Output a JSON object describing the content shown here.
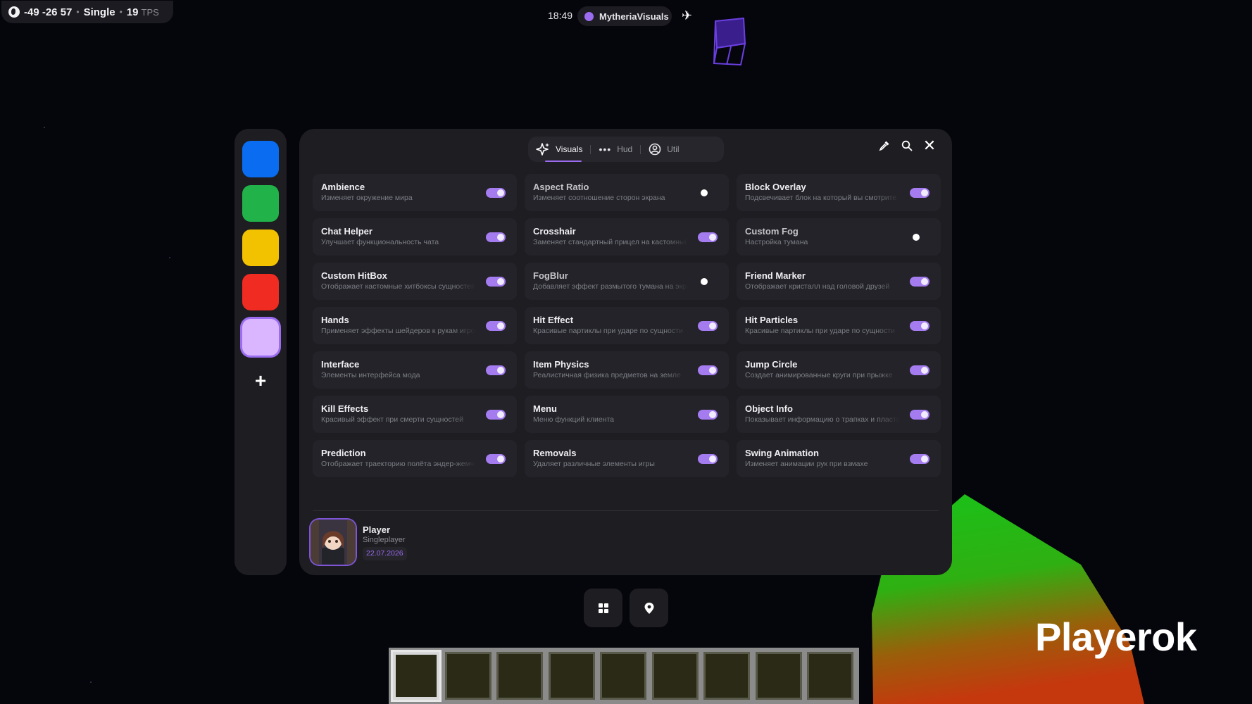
{
  "hud": {
    "coordinates": "-49 -26 57",
    "mode": "Single",
    "tps_value": "19",
    "tps_unit": "TPS",
    "time": "18:49",
    "client_name": "MytheriaVisuals"
  },
  "colors": {
    "accent": "#9b6bf0",
    "swatches": [
      "#0a6cf0",
      "#21b34a",
      "#f2c200",
      "#ef2b22",
      "#d9b6ff"
    ]
  },
  "color_panel": {
    "add_label": "+"
  },
  "tabs": [
    {
      "label": "Visuals",
      "icon": "sparkle-icon",
      "active": true
    },
    {
      "label": "Hud",
      "icon": "dots-icon",
      "active": false
    },
    {
      "label": "Util",
      "icon": "user-icon",
      "active": false
    }
  ],
  "modules": [
    {
      "name": "Ambience",
      "desc": "Изменяет окружение мира",
      "enabled": true
    },
    {
      "name": "Aspect Ratio",
      "desc": "Изменяет соотношение сторон экрана",
      "enabled": false
    },
    {
      "name": "Block Overlay",
      "desc": "Подсвечивает блок на который вы смотрите",
      "enabled": true
    },
    {
      "name": "Chat Helper",
      "desc": "Улучшает функциональность чата",
      "enabled": true
    },
    {
      "name": "Crosshair",
      "desc": "Заменяет стандартный прицел на кастомный",
      "enabled": true
    },
    {
      "name": "Custom Fog",
      "desc": "Настройка тумана",
      "enabled": false
    },
    {
      "name": "Custom HitBox",
      "desc": "Отображает кастомные хитбоксы сущностей",
      "enabled": true
    },
    {
      "name": "FogBlur",
      "desc": "Добавляет эффект размытого тумана на экране",
      "enabled": false
    },
    {
      "name": "Friend Marker",
      "desc": "Отображает кристалл над головой друзей",
      "enabled": true
    },
    {
      "name": "Hands",
      "desc": "Применяет эффекты шейдеров к рукам игрока",
      "enabled": true
    },
    {
      "name": "Hit Effect",
      "desc": "Красивые партиклы при ударе по сущности",
      "enabled": true
    },
    {
      "name": "Hit Particles",
      "desc": "Красивые партиклы при ударе по сущности",
      "enabled": true
    },
    {
      "name": "Interface",
      "desc": "Элементы интерфейса мода",
      "enabled": true
    },
    {
      "name": "Item Physics",
      "desc": "Реалистичная физика предметов на земле",
      "enabled": true
    },
    {
      "name": "Jump Circle",
      "desc": "Создает анимированные круги при прыжке",
      "enabled": true
    },
    {
      "name": "Kill Effects",
      "desc": "Красивый эффект при смерти сущностей",
      "enabled": true
    },
    {
      "name": "Menu",
      "desc": "Меню функций клиента",
      "enabled": true
    },
    {
      "name": "Object Info",
      "desc": "Показывает информацию о трапках и пластах",
      "enabled": true
    },
    {
      "name": "Prediction",
      "desc": "Отображает траекторию полёта эндер-жемчуга",
      "enabled": true
    },
    {
      "name": "Removals",
      "desc": "Удаляет различные элементы игры",
      "enabled": true
    },
    {
      "name": "Swing Animation",
      "desc": "Изменяет анимации рук при взмахе",
      "enabled": true
    }
  ],
  "profile": {
    "name": "Player",
    "mode": "Singleplayer",
    "date": "22.07.2026"
  },
  "hotbar": {
    "slots": 9,
    "selected": 0
  },
  "brand": "Playerok"
}
